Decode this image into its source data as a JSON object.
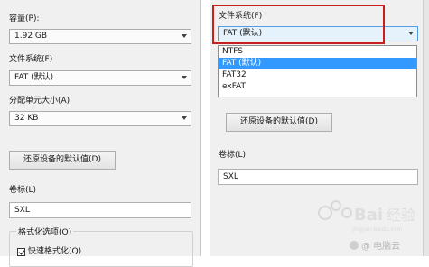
{
  "left": {
    "capacity_label": "容量(P):",
    "capacity_value": "1.92 GB",
    "filesystem_label": "文件系统(F)",
    "filesystem_value": "FAT (默认)",
    "alloc_label": "分配单元大小(A)",
    "alloc_value": "32 KB",
    "restore_button": "还原设备的默认值(D)",
    "volume_label": "卷标(L)",
    "volume_value": "SXL",
    "format_options_label": "格式化选项(O)",
    "quick_format_label": "快速格式化(Q)"
  },
  "right": {
    "filesystem_label": "文件系统(F)",
    "filesystem_value": "FAT (默认)",
    "options": [
      "NTFS",
      "FAT (默认)",
      "FAT32",
      "exFAT"
    ],
    "selected_index": 1,
    "restore_button": "还原设备的默认值(D)",
    "volume_label": "卷标(L)",
    "volume_value": "SXL"
  },
  "watermark": {
    "text": "Bai 经验",
    "sub": "jingyan.baidu.com",
    "brand": "@ 电脑云"
  },
  "colors": {
    "highlight": "#c81e1e",
    "selection": "#3399ff"
  }
}
